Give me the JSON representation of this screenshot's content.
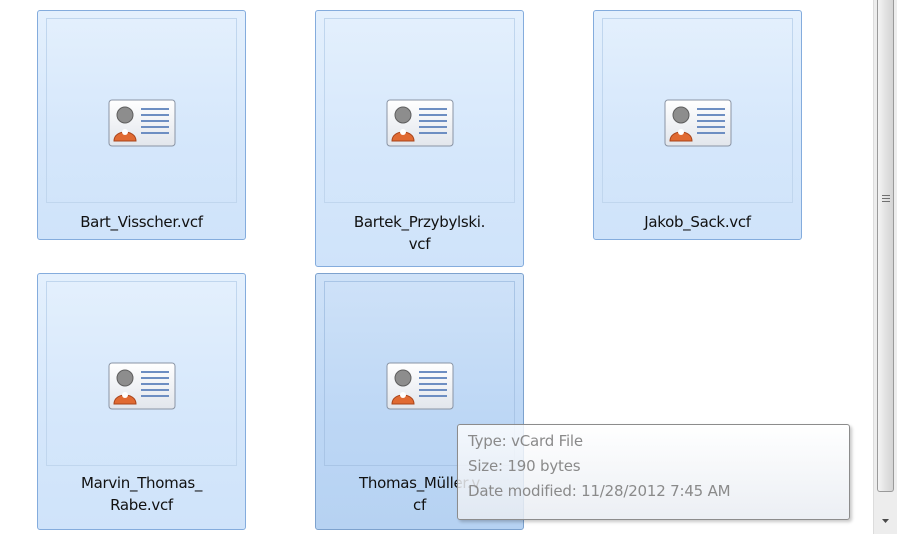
{
  "files": [
    {
      "name": "Bart_Visscher.vcf",
      "selected": false
    },
    {
      "name": "Bartek_Przybylski.\nvcf",
      "selected": false
    },
    {
      "name": "Jakob_Sack.vcf",
      "selected": false
    },
    {
      "name": "Marvin_Thomas_\nRabe.vcf",
      "selected": false
    },
    {
      "name": "Thomas_Müller.v\ncf",
      "selected": true
    }
  ],
  "tooltip": {
    "type": "Type: vCard File",
    "size": "Size: 190 bytes",
    "date_modified": "Date modified: 11/28/2012 7:45 AM"
  },
  "icons": {
    "file_icon": "vcard-contact-icon",
    "scroll_down": "scroll-down-arrow-icon"
  },
  "colors": {
    "tile_fill": "#d5e7fb",
    "tile_selected_fill": "#bdd7f5",
    "tile_border": "#84acdd"
  }
}
